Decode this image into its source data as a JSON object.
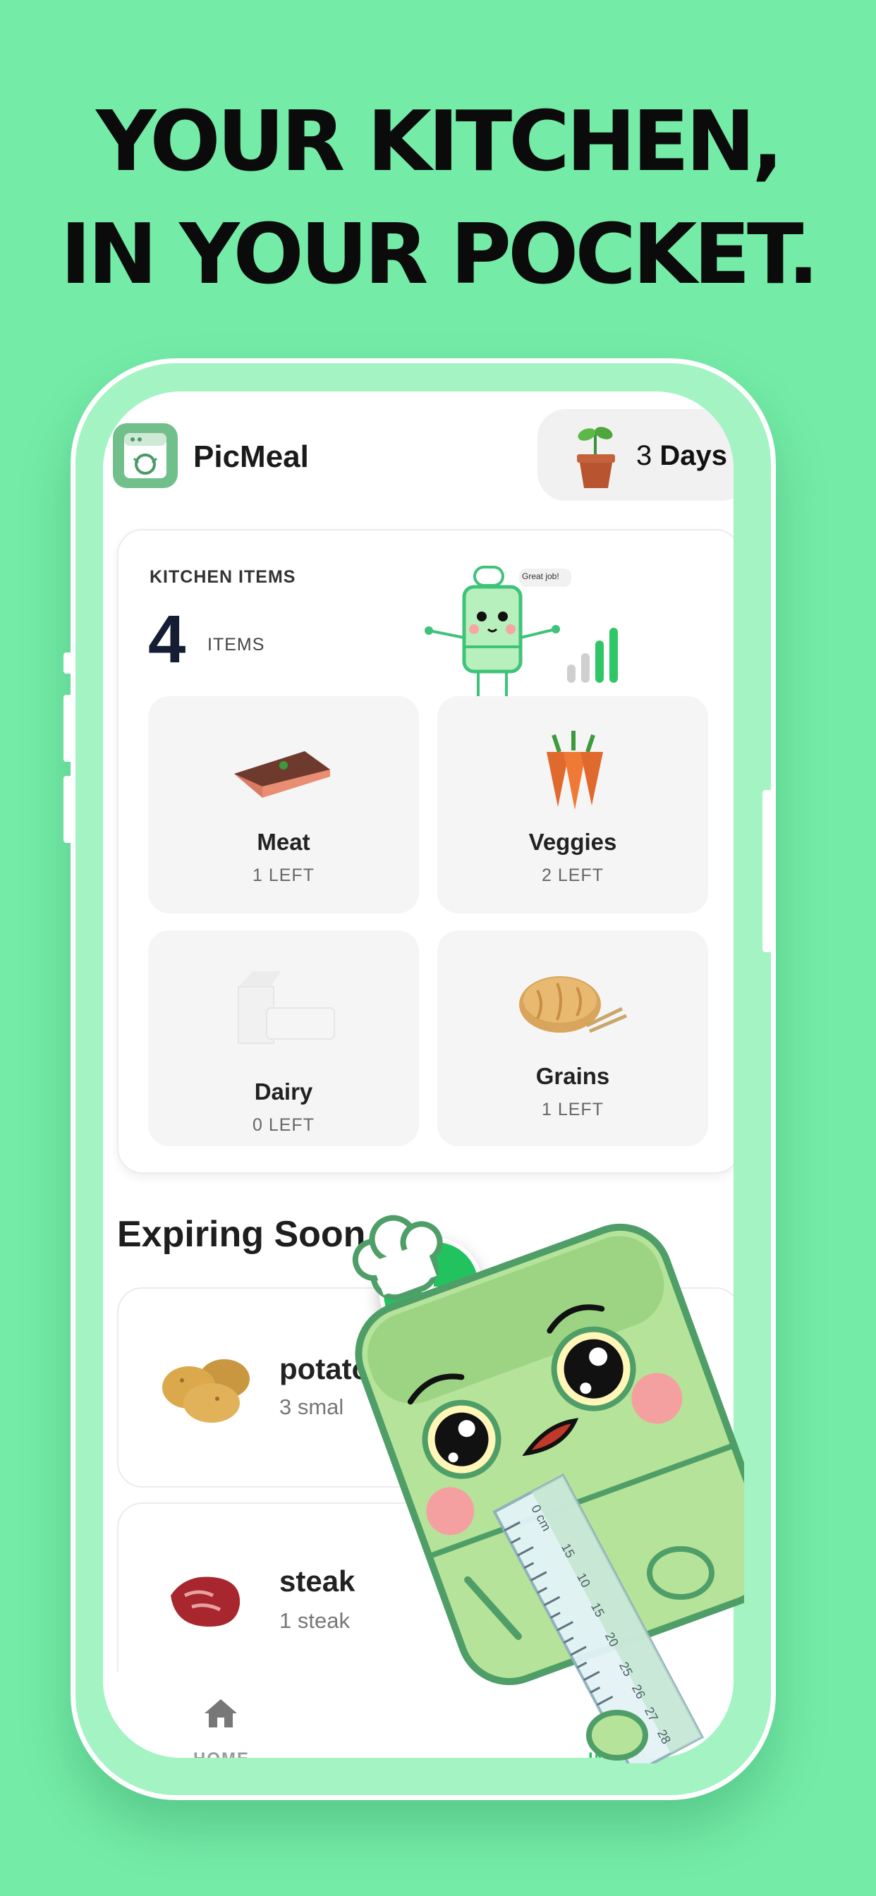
{
  "headline": {
    "line1": "YOUR KITCHEN,",
    "line2": "IN YOUR POCKET."
  },
  "app": {
    "name": "PicMeal",
    "icon": "fridge-icon"
  },
  "streak": {
    "icon": "sprout-icon",
    "count": "3",
    "unit": "Days"
  },
  "kitchen": {
    "label": "KITCHEN ITEMS",
    "count": "4",
    "unit": "ITEMS",
    "speech": "Great job!",
    "categories": [
      {
        "name": "Meat",
        "left": "1 LEFT",
        "icon": "salmon-icon"
      },
      {
        "name": "Veggies",
        "left": "2 LEFT",
        "icon": "carrot-icon"
      },
      {
        "name": "Dairy",
        "left": "0 LEFT",
        "icon": "milk-icon"
      },
      {
        "name": "Grains",
        "left": "1 LEFT",
        "icon": "bread-icon"
      }
    ]
  },
  "expiring": {
    "title": "Expiring Soon",
    "items": [
      {
        "name": "potato",
        "qty": "3 smal",
        "icon": "potato-icon"
      },
      {
        "name": "steak",
        "qty": "1 steak",
        "icon": "steak-icon"
      }
    ]
  },
  "nav": {
    "home": "HOME",
    "inventory": "INVEN",
    "fab_icon": "plus-icon",
    "accent": "#22c35e"
  },
  "ruler": {
    "unit": "0 cm",
    "ticks": [
      "15",
      "10",
      "15",
      "20",
      "25",
      "26",
      "27",
      "28"
    ]
  }
}
